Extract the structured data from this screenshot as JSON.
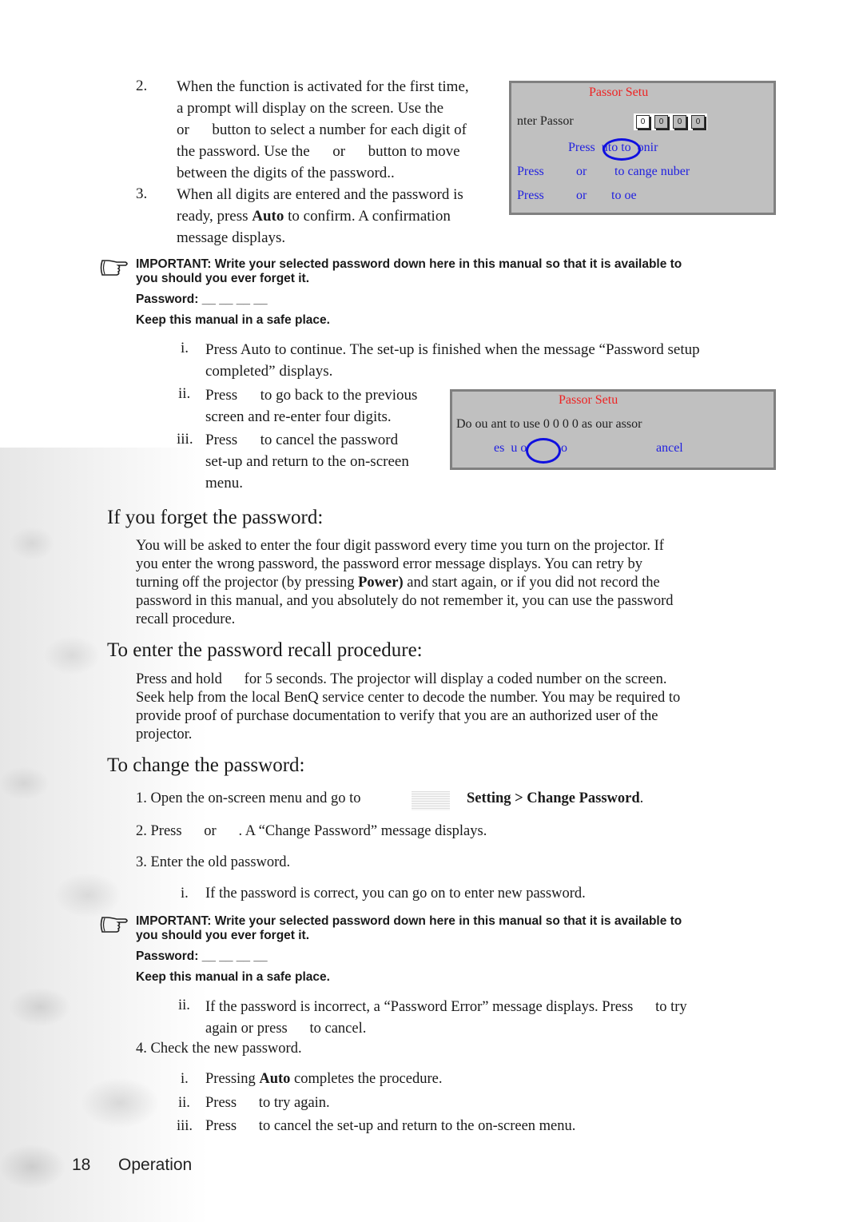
{
  "step2": {
    "number": "2.",
    "lines": [
      "When the function is activated for the first time,",
      "a prompt will display on the screen. Use the",
      "or      button to select a number for each digit of",
      "the password. Use the      or      button to move",
      "between the digits of the password.."
    ]
  },
  "step3": {
    "number": "3.",
    "line1": "When all digits are entered and the password is",
    "line2_pre": "ready, press ",
    "line2_bold": "Auto",
    "line2_post": " to confirm. A confirmation",
    "line3": "message displays."
  },
  "osd1": {
    "title": "Passor Setu",
    "enter_label": "nter Passor",
    "digits": [
      "0",
      "0",
      "0",
      "0"
    ],
    "confirm": "Press  uto to  onir",
    "row1_press": "Press",
    "row1_or": "or",
    "row1_action": "to cange nuber",
    "row2_press": "Press",
    "row2_or": "or",
    "row2_action": "to oe"
  },
  "important1": {
    "line1": "IMPORTANT: Write your selected password down here in this manual so that it is available to",
    "line2": "you should you ever forget it.",
    "password": "Password: __ __ __ __",
    "keep": "Keep this manual in a safe place."
  },
  "sub_i": {
    "num": "i.",
    "line1": "Press Auto to continue. The set-up is finished when the message “Password setup",
    "line2": "completed” displays."
  },
  "sub_ii": {
    "num": "ii.",
    "line1": "Press      to go back to the previous",
    "line2": "screen and re-enter four digits."
  },
  "sub_iii": {
    "num": "iii.",
    "line1": "Press      to cancel the password",
    "line2": "set-up and return to the on-screen",
    "line3": "menu."
  },
  "osd2": {
    "title": "Passor Setu",
    "question": "Do ou ant to use 0 0 0 0 as our assor",
    "yes": "es  u o",
    "no": "o",
    "cancel": "ancel"
  },
  "forget": {
    "heading": "If you forget the password:",
    "l1": "You will be asked to enter the four digit password every time you turn on the projector. If",
    "l2": "you enter the wrong password, the password error message displays. You can retry by",
    "l3_pre": "turning off the projector (by pressing ",
    "l3_bold": "Power)",
    "l3_post": " and start again, or if you did not record the",
    "l4": "password in this manual, and you absolutely do not remember it, you can use the password",
    "l5": "recall procedure."
  },
  "recall": {
    "heading": "To enter the password recall procedure:",
    "l1": "Press and hold      for 5 seconds. The projector will display a coded number on the screen.",
    "l2": "Seek help from the local BenQ service center to decode the number. You may be required to",
    "l3": "provide proof of purchase documentation to verify that you are an authorized user of the",
    "l4": "projector."
  },
  "change": {
    "heading": "To change the password:",
    "s1_pre": "1. Open the on-screen menu and go to",
    "s1_bold": "Setting > Change Password",
    "s1_post": ".",
    "s2": "2. Press      or      . A “Change Password” message displays.",
    "s3": "3. Enter the old password.",
    "s3_i_num": "i.",
    "s3_i": "If the password is correct, you can go on to enter new password.",
    "s3_ii_num": "ii.",
    "s3_ii_l1": "If the password is incorrect, a “Password Error” message displays. Press      to try",
    "s3_ii_l2": "again or press      to cancel.",
    "s4": "4. Check the new password.",
    "s4_i_num": "i.",
    "s4_i_pre": "Pressing ",
    "s4_i_bold": "Auto",
    "s4_i_post": " completes the procedure.",
    "s4_ii_num": "ii.",
    "s4_ii": "Press      to try again.",
    "s4_iii_num": "iii.",
    "s4_iii": "Press      to cancel the set-up and return to the on-screen menu."
  },
  "important2": {
    "line1": "IMPORTANT: Write your selected password down here in this manual so that it is available to",
    "line2": "you should you ever forget it.",
    "password": "Password: __ __ __ __",
    "keep": "Keep this manual in a safe place."
  },
  "footer": {
    "page": "18",
    "section": "Operation"
  }
}
